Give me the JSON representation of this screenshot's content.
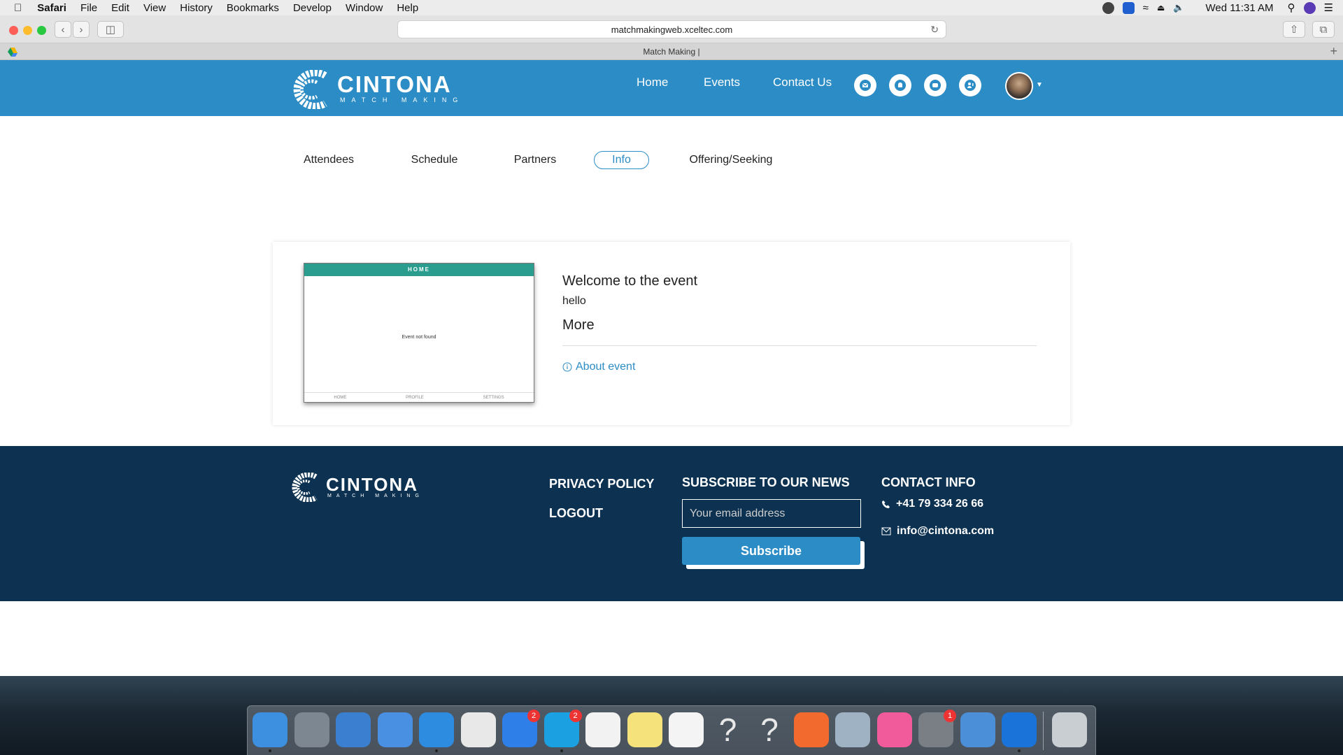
{
  "menubar": {
    "app": "Safari",
    "items": [
      "File",
      "Edit",
      "View",
      "History",
      "Bookmarks",
      "Develop",
      "Window",
      "Help"
    ],
    "clock": "Wed 11:31 AM"
  },
  "browser": {
    "url": "matchmakingweb.xceltec.com",
    "tab_title": "Match Making |"
  },
  "header": {
    "brand": "CINTONA",
    "brand_sub": "MATCH MAKING",
    "nav": [
      "Home",
      "Events",
      "Contact Us"
    ],
    "icons": [
      "envelope-icon",
      "bell-icon",
      "chat-icon",
      "person-mic-icon"
    ]
  },
  "tabs": [
    {
      "label": "Attendees",
      "active": false
    },
    {
      "label": "Schedule",
      "active": false
    },
    {
      "label": "Partners",
      "active": false
    },
    {
      "label": "Info",
      "active": true
    },
    {
      "label": "Offering/Seeking",
      "active": false
    }
  ],
  "event": {
    "thumb_header": "HOME",
    "thumb_message": "Event not found",
    "thumb_tabs": [
      "HOME",
      "PROFILE",
      "SETTINGS"
    ],
    "welcome": "Welcome to the event",
    "description": "hello",
    "more_heading": "More",
    "about_link": "About event"
  },
  "footer": {
    "brand": "CINTONA",
    "brand_sub": "MATCH MAKING",
    "links": [
      "PRIVACY POLICY",
      "LOGOUT"
    ],
    "subscribe_heading": "SUBSCRIBE TO OUR NEWS",
    "email_placeholder": "Your email address",
    "subscribe_button": "Subscribe",
    "contact_heading": "CONTACT INFO",
    "phone": "+41 79 334 26 66",
    "email": "info@cintona.com"
  },
  "dock": {
    "apps": [
      {
        "name": "finder",
        "color": "#3d8fe0"
      },
      {
        "name": "launchpad",
        "color": "#7d8791"
      },
      {
        "name": "xcode",
        "color": "#3a7fd0"
      },
      {
        "name": "simulator",
        "color": "#4a90e2"
      },
      {
        "name": "safari",
        "color": "#2e8ce0"
      },
      {
        "name": "chrome",
        "color": "#e8e8e8"
      },
      {
        "name": "app-store",
        "color": "#2f7fe8",
        "badge": "2"
      },
      {
        "name": "skype",
        "color": "#1ba0e2",
        "badge": "2"
      },
      {
        "name": "webstorm",
        "color": "#f2f2f2"
      },
      {
        "name": "notes",
        "color": "#f5e27a"
      },
      {
        "name": "textedit",
        "color": "#f4f4f4"
      },
      {
        "name": "unknown-app-1",
        "color": "transparent"
      },
      {
        "name": "unknown-app-2",
        "color": "transparent"
      },
      {
        "name": "sketch-pen",
        "color": "#f26a2d"
      },
      {
        "name": "preview",
        "color": "#9fb2c4"
      },
      {
        "name": "itunes",
        "color": "#f15a9b"
      },
      {
        "name": "system-preferences",
        "color": "#7a7f86",
        "badge": "1"
      },
      {
        "name": "mail-app",
        "color": "#4a8fd8"
      },
      {
        "name": "teamviewer",
        "color": "#1a73d9"
      },
      {
        "name": "trash",
        "color": "#c9ced3"
      }
    ]
  }
}
